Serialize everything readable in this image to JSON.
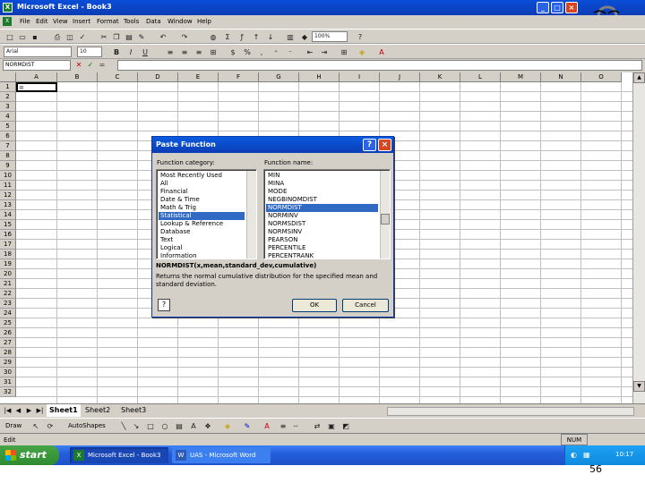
{
  "window": {
    "title": "Microsoft Excel - Book3"
  },
  "menu": [
    "File",
    "Edit",
    "View",
    "Insert",
    "Format",
    "Tools",
    "Data",
    "Window",
    "Help"
  ],
  "toolbar": {
    "zoom": "100%",
    "font": "Arial",
    "font_size": "10"
  },
  "formula_bar": {
    "name_box": "NORMDIST",
    "equals": "="
  },
  "columns": [
    "A",
    "B",
    "C",
    "D",
    "E",
    "F",
    "G",
    "H",
    "I",
    "J",
    "K",
    "L",
    "M",
    "N",
    "O"
  ],
  "rows": [
    "1",
    "2",
    "3",
    "4",
    "5",
    "6",
    "7",
    "8",
    "9",
    "10",
    "11",
    "12",
    "13",
    "14",
    "15",
    "16",
    "17",
    "18",
    "19",
    "20",
    "21",
    "22",
    "23",
    "24",
    "25",
    "26",
    "27",
    "28",
    "29",
    "30",
    "31",
    "32"
  ],
  "active_cell": {
    "content": "="
  },
  "sheets": [
    "Sheet1",
    "Sheet2",
    "Sheet3"
  ],
  "drawbar": {
    "draw": "Draw",
    "autoshapes": "AutoShapes"
  },
  "status": {
    "mode": "Edit",
    "num": "NUM"
  },
  "taskbar": {
    "start": "start",
    "tasks": [
      "Microsoft Excel - Book3",
      "UAS - Microsoft Word"
    ],
    "clock": "10:17"
  },
  "dialog": {
    "title": "Paste Function",
    "category_label": "Function category:",
    "name_label": "Function name:",
    "categories": [
      "Most Recently Used",
      "All",
      "Financial",
      "Date & Time",
      "Math & Trig",
      "Statistical",
      "Lookup & Reference",
      "Database",
      "Text",
      "Logical",
      "Information"
    ],
    "selected_category": 5,
    "functions": [
      "MIN",
      "MINA",
      "MODE",
      "NEGBINOMDIST",
      "NORMDIST",
      "NORMINV",
      "NORMSDIST",
      "NORMSINV",
      "PEARSON",
      "PERCENTILE",
      "PERCENTRANK"
    ],
    "selected_function": 4,
    "signature": "NORMDIST(x,mean,standard_dev,cumulative)",
    "description": "Returns the normal cumulative distribution for the specified mean and standard deviation.",
    "ok": "OK",
    "cancel": "Cancel"
  },
  "slide_number": "56",
  "colors": {
    "title_blue": "#0b3cb4",
    "selection": "#316ac5",
    "start_green": "#2f8a2f"
  }
}
